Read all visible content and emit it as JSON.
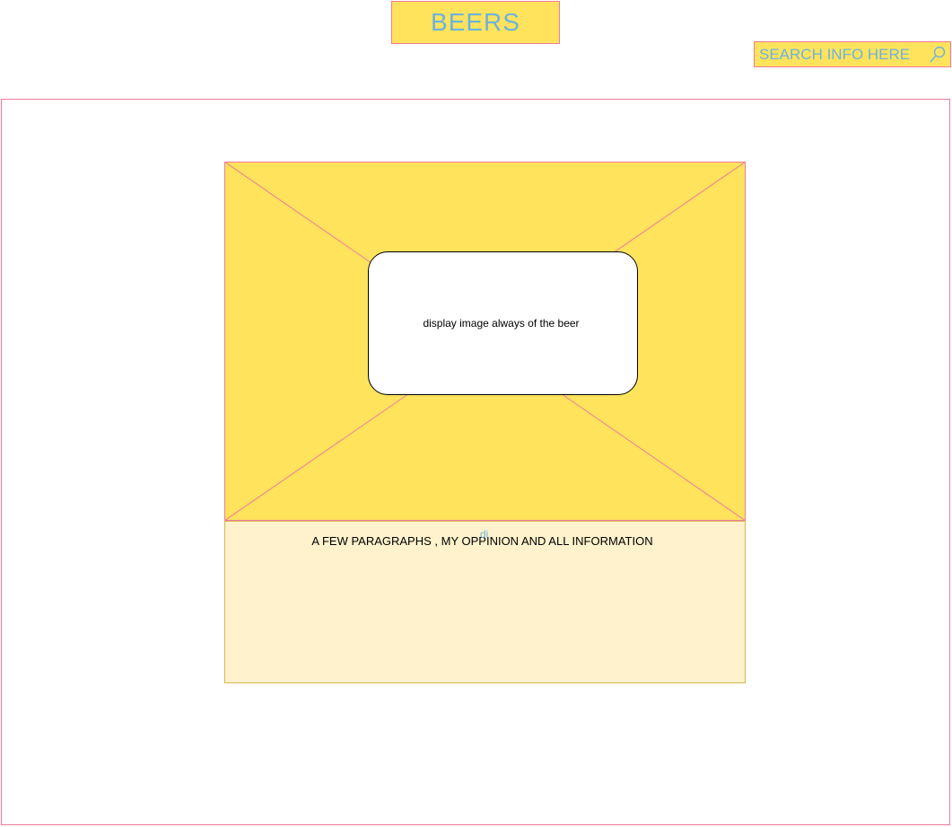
{
  "header": {
    "title": "BEERS"
  },
  "search": {
    "placeholder": "SEARCH INFO HERE",
    "icon": "search-icon"
  },
  "main": {
    "image_caption": "display image always of the beer",
    "content_text": "A FEW PARAGRAPHS , MY OPPINION AND ALL INFORMATION",
    "cursor_label": "di"
  },
  "colors": {
    "accent_yellow": "#ffe35c",
    "light_yellow": "#fff2cc",
    "border_pink": "#f07a9a",
    "text_blue": "#6cb2dd"
  }
}
